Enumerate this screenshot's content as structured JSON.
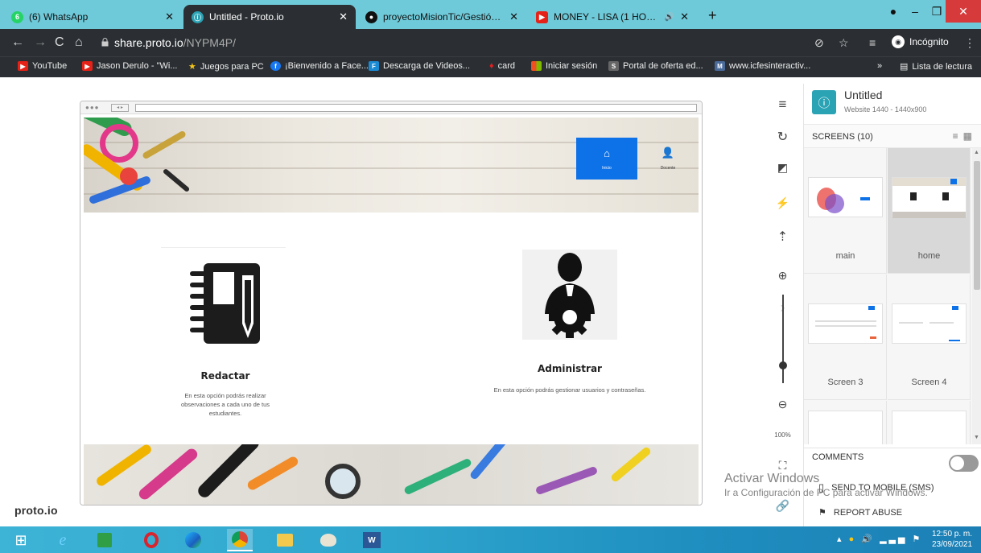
{
  "browser": {
    "tabs": [
      {
        "label": "(6) WhatsApp",
        "favicon": "whatsapp-icon",
        "badge": "6",
        "active": false
      },
      {
        "label": "Untitled - Proto.io",
        "favicon": "protoio-icon",
        "active": true
      },
      {
        "label": "proyectoMisionTic/GestióndeCor",
        "favicon": "github-icon",
        "active": false
      },
      {
        "label": "MONEY - LISA (1 HOUR LOO",
        "favicon": "youtube-icon",
        "active": false
      }
    ],
    "address": {
      "host": "share.proto.io",
      "path": "/NYPM4P/"
    },
    "incognito_label": "Incógnito",
    "bookmarks": [
      "YouTube",
      "Jason Derulo - \"Wi...",
      "Juegos para PC",
      "¡Bienvenido a Face...",
      "Descarga de Videos...",
      "card",
      "Iniciar sesión",
      "Portal de oferta ed...",
      "www.icfesinteractiv..."
    ],
    "reading_list": "Lista de lectura"
  },
  "mockup": {
    "nav": [
      {
        "label": "Inicio",
        "icon": "home-icon",
        "active": true
      },
      {
        "label": "Docente",
        "icon": "user-icon",
        "active": false
      }
    ],
    "cards": [
      {
        "title": "Redactar",
        "desc": "En esta opción podrás  realizar observaciones a cada uno de tus estudiantes.",
        "icon": "notebook-icon"
      },
      {
        "title": "Administrar",
        "desc": "En esta opción podrás gestionar usuarios y contraseñas.",
        "icon": "admin-gear-icon"
      }
    ]
  },
  "brand": "proto.io",
  "sidebar_tools": {
    "zoom_level": "100%"
  },
  "panel": {
    "project_title": "Untitled",
    "project_sub": "Website 1440 - 1440x900",
    "screens_label": "SCREENS (10)",
    "screens": [
      {
        "name": "main",
        "selected": false
      },
      {
        "name": "home",
        "selected": true
      },
      {
        "name": "Screen 3",
        "selected": false
      },
      {
        "name": "Screen 4",
        "selected": false
      }
    ],
    "comments_label": "COMMENTS",
    "send_label": "SEND TO MOBILE (SMS)",
    "report_label": "REPORT ABUSE"
  },
  "watermark": {
    "line1": "Activar Windows",
    "line2": "Ir a Configuración de PC para activar Windows."
  },
  "taskbar": {
    "time": "12:50 p. m.",
    "date": "23/09/2021"
  },
  "colors": {
    "accent_blue": "#0d71e8",
    "teal": "#2aa3b5",
    "tab_strip": "#6ec9d8"
  }
}
